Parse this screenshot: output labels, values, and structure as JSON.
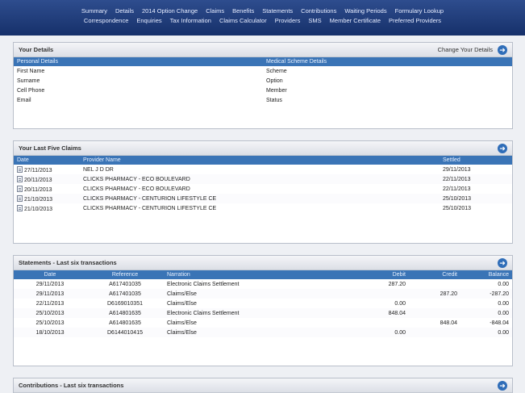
{
  "nav": {
    "row1": [
      "Summary",
      "Details",
      "2014 Option Change",
      "Claims",
      "Benefits",
      "Statements",
      "Contributions",
      "Waiting Periods",
      "Formulary Lookup"
    ],
    "row2": [
      "Correspondence",
      "Enquiries",
      "Tax Information",
      "Claims Calculator",
      "Providers",
      "SMS",
      "Member Certificate",
      "Preferred Providers"
    ]
  },
  "your_details": {
    "title": "Your Details",
    "change_link": "Change Your Details",
    "col_personal": "Personal Details",
    "col_scheme": "Medical Scheme Details",
    "rows": [
      {
        "left": "First Name",
        "right": "Scheme"
      },
      {
        "left": "Surname",
        "right": "Option"
      },
      {
        "left": "Cell Phone",
        "right": "Member"
      },
      {
        "left": "Email",
        "right": "Status"
      }
    ]
  },
  "claims": {
    "title": "Your Last Five Claims",
    "headers": [
      "Date",
      "Provider Name",
      "Settled"
    ],
    "rows": [
      {
        "date": "27/11/2013",
        "provider": "NEL J D DR",
        "settled": "29/11/2013"
      },
      {
        "date": "20/11/2013",
        "provider": "CLICKS PHARMACY - ECO BOULEVARD",
        "settled": "22/11/2013"
      },
      {
        "date": "20/11/2013",
        "provider": "CLICKS PHARMACY - ECO BOULEVARD",
        "settled": "22/11/2013"
      },
      {
        "date": "21/10/2013",
        "provider": "CLICKS PHARMACY - CENTURION LIFESTYLE CE",
        "settled": "25/10/2013"
      },
      {
        "date": "21/10/2013",
        "provider": "CLICKS PHARMACY - CENTURION LIFESTYLE CE",
        "settled": "25/10/2013"
      }
    ]
  },
  "statements": {
    "title": "Statements - Last six transactions",
    "headers": [
      "Date",
      "Reference",
      "Narration",
      "Debit",
      "Credit",
      "Balance"
    ],
    "rows": [
      {
        "date": "29/11/2013",
        "ref": "A617401035",
        "narr": "Electronic Claims Settlement",
        "debit": "287.20",
        "credit": "",
        "balance": "0.00"
      },
      {
        "date": "29/11/2013",
        "ref": "A617401035",
        "narr": "Claims/Else",
        "debit": "",
        "credit": "287.20",
        "balance": "-287.20"
      },
      {
        "date": "22/11/2013",
        "ref": "D6169010351",
        "narr": "Claims/Else",
        "debit": "0.00",
        "credit": "",
        "balance": "0.00"
      },
      {
        "date": "25/10/2013",
        "ref": "A614801635",
        "narr": "Electronic Claims Settlement",
        "debit": "848.04",
        "credit": "",
        "balance": "0.00"
      },
      {
        "date": "25/10/2013",
        "ref": "A614801635",
        "narr": "Claims/Else",
        "debit": "",
        "credit": "848.04",
        "balance": "-848.04"
      },
      {
        "date": "18/10/2013",
        "ref": "D6144010415",
        "narr": "Claims/Else",
        "debit": "0.00",
        "credit": "",
        "balance": "0.00"
      }
    ]
  },
  "contributions": {
    "title": "Contributions - Last six transactions"
  }
}
